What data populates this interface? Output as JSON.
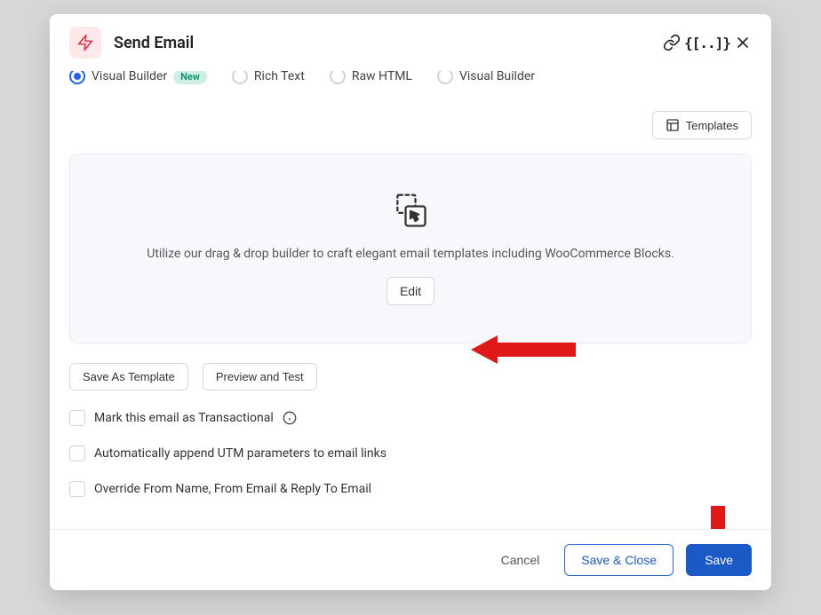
{
  "modal": {
    "title": "Send Email",
    "tabs": {
      "options": [
        {
          "label": "Visual Builder",
          "selected": true,
          "badge": "New"
        },
        {
          "label": "Rich Text",
          "selected": false
        },
        {
          "label": "Raw HTML",
          "selected": false
        },
        {
          "label": "Visual Builder",
          "selected": false
        }
      ]
    },
    "templatesBtn": "Templates",
    "builder": {
      "desc": "Utilize our drag & drop builder to craft elegant email templates including WooCommerce Blocks.",
      "editBtn": "Edit"
    },
    "actions": {
      "saveAsTemplate": "Save As Template",
      "previewTest": "Preview and Test"
    },
    "checks": {
      "transactional": "Mark this email as Transactional",
      "utm": "Automatically append UTM parameters to email links",
      "overrideFrom": "Override From Name, From Email & Reply To Email"
    },
    "footer": {
      "cancel": "Cancel",
      "saveClose": "Save & Close",
      "save": "Save"
    }
  }
}
